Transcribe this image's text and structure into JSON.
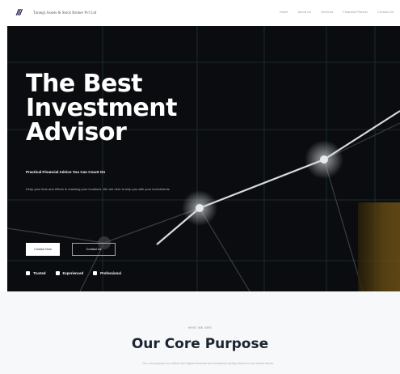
{
  "brand": {
    "logo_text": "///",
    "name": "Tarangi Assets & Stock Broker Pvt Ltd"
  },
  "nav": {
    "items": [
      "Home",
      "About Us",
      "Services",
      "Financial Planner",
      "Contact Us"
    ]
  },
  "hero": {
    "title": "The Best Investment Advisor",
    "subtitle": "Practical Financial Advice You Can Count On",
    "description": "Keep your time and efforts in reaching your locations. We are here to help you with your investments",
    "primary_button": "Contact Now",
    "secondary_button": "Contact Us",
    "badges": [
      "Trusted",
      "Experienced",
      "Professional"
    ],
    "colors": {
      "background": "#0b0c0f",
      "accent_gold": "#6b5014"
    }
  },
  "purpose": {
    "eyebrow": "WHO WE ARE",
    "title": "Our Core Purpose",
    "text": "Our core purpose is to deliver the highest financial and investment quality service to our valued clients."
  }
}
